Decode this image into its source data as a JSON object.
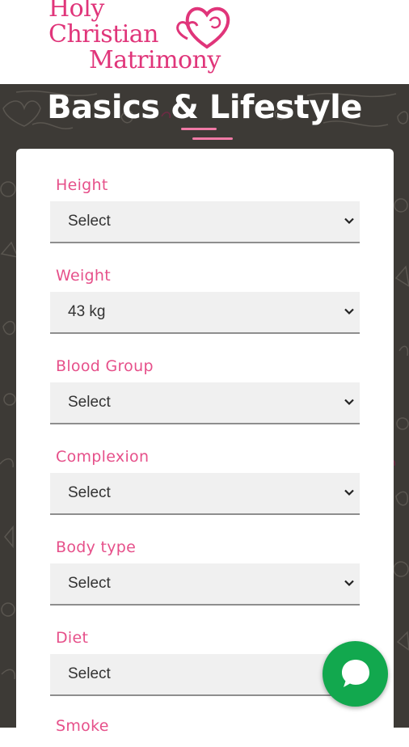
{
  "logo": {
    "line1": "Holy",
    "line2": "Christian",
    "line3": "Matrimony"
  },
  "page": {
    "title": "Basics & Lifestyle"
  },
  "form": {
    "height": {
      "label": "Height",
      "value": "Select"
    },
    "weight": {
      "label": "Weight",
      "value": "43 kg"
    },
    "blood_group": {
      "label": "Blood Group",
      "value": "Select"
    },
    "complexion": {
      "label": "Complexion",
      "value": "Select"
    },
    "body_type": {
      "label": "Body type",
      "value": "Select"
    },
    "diet": {
      "label": "Diet",
      "value": "Select"
    },
    "smoke": {
      "label": "Smoke"
    }
  },
  "colors": {
    "brand": "#e0357a",
    "label": "#e6508a",
    "chat": "#12a84e",
    "background": "#3d3a36"
  },
  "icons": {
    "select_arrow": "chevron-down-icon",
    "chat": "chat-bubble-icon",
    "logo": "hearts-icon"
  }
}
